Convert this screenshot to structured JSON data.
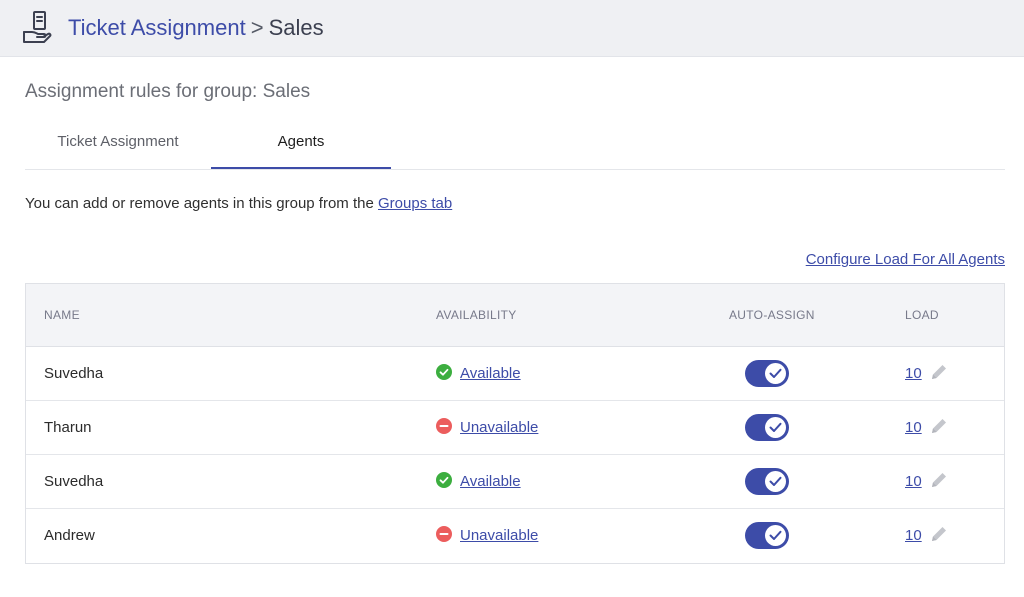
{
  "header": {
    "icon": "ticket-hand-icon",
    "breadcrumb_link": "Ticket Assignment",
    "separator": ">",
    "current": "Sales"
  },
  "page": {
    "heading": "Assignment rules for group: Sales"
  },
  "tabs": [
    {
      "label": "Ticket Assignment",
      "active": false
    },
    {
      "label": "Agents",
      "active": true
    }
  ],
  "info": {
    "text": "You can add or remove agents in this group from the ",
    "link": "Groups tab"
  },
  "configure_link": "Configure Load For All Agents",
  "table": {
    "columns": [
      "NAME",
      "AVAILABILITY",
      "AUTO-ASSIGN",
      "LOAD"
    ],
    "rows": [
      {
        "name": "Suvedha",
        "availability": "Available",
        "status": "available",
        "auto_assign": true,
        "load": "10"
      },
      {
        "name": "Tharun",
        "availability": "Unavailable",
        "status": "unavailable",
        "auto_assign": true,
        "load": "10"
      },
      {
        "name": "Suvedha",
        "availability": "Available",
        "status": "available",
        "auto_assign": true,
        "load": "10"
      },
      {
        "name": "Andrew",
        "availability": "Unavailable",
        "status": "unavailable",
        "auto_assign": true,
        "load": "10"
      }
    ]
  },
  "colors": {
    "accent": "#3d4ca8",
    "available": "#3cae3f",
    "unavailable": "#ec5d5d"
  }
}
